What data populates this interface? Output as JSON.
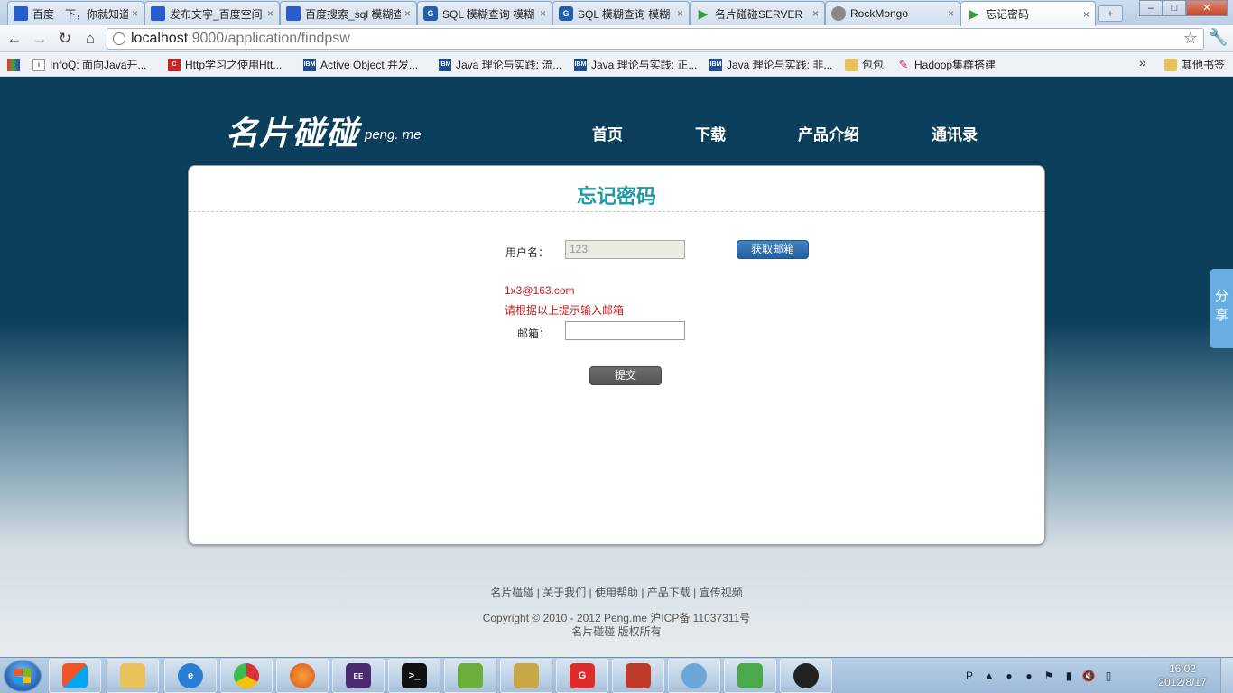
{
  "browser": {
    "tabs": [
      {
        "label": "百度一下，你就知道",
        "icon": "baidu-icon",
        "close": "×"
      },
      {
        "label": "发布文字_百度空间",
        "icon": "baidu-icon",
        "close": "×"
      },
      {
        "label": "百度搜索_sql 模糊查询",
        "icon": "baidu-icon",
        "close": "×"
      },
      {
        "label": "SQL 模糊查询 模糊",
        "icon": "g-icon",
        "close": "×"
      },
      {
        "label": "SQL 模糊查询 模糊",
        "icon": "g-icon",
        "close": "×"
      },
      {
        "label": "名片碰碰SERVER",
        "icon": "play-icon",
        "close": "×"
      },
      {
        "label": "RockMongo",
        "icon": "mongo-icon",
        "close": "×"
      },
      {
        "label": "忘记密码",
        "icon": "play-icon",
        "close": "×"
      }
    ],
    "new_tab": "+",
    "minimize": "–",
    "maximize": "□",
    "close": "✕",
    "back": "←",
    "forward": "→",
    "reload": "↻",
    "home": "⌂",
    "url_host": "localhost",
    "url_rest": ":9000/application/findpsw",
    "star": "☆",
    "wrench": "🔧",
    "bookmarks": [
      {
        "label": "",
        "icon": "google-apps-icon"
      },
      {
        "label": "InfoQ: 面向Java开...",
        "icon": "infoq-icon"
      },
      {
        "label": "Http学习之使用Htt...",
        "icon": "c-icon"
      },
      {
        "label": "Active Object 并发...",
        "icon": "ibm-icon"
      },
      {
        "label": "Java 理论与实践: 流...",
        "icon": "ibm-icon"
      },
      {
        "label": "Java 理论与实践: 正...",
        "icon": "ibm-icon"
      },
      {
        "label": "Java 理论与实践: 非...",
        "icon": "ibm-icon"
      },
      {
        "label": "包包",
        "icon": "folder-icon"
      },
      {
        "label": "Hadoop集群搭建",
        "icon": "feather-icon"
      }
    ],
    "bookmarks_more": "»",
    "other_bookmarks": "其他书签"
  },
  "site": {
    "logo": "名片碰碰",
    "logo_sub": "peng. me",
    "nav": [
      "首页",
      "下载",
      "产品介绍",
      "通讯录"
    ],
    "share": "分享"
  },
  "form": {
    "title": "忘记密码",
    "username_label": "用户名：",
    "username_value": "123",
    "get_email_button": "获取邮箱",
    "hint_email": "1x3@163.com",
    "hint_text": "请根据以上提示输入邮箱",
    "email_label": "邮箱：",
    "email_value": "",
    "submit_button": "提交"
  },
  "footer": {
    "links": "名片碰碰 | 关于我们 | 使用帮助 | 产品下载 | 宣传视频",
    "copyright": "Copyright © 2010 - 2012 Peng.me 沪ICP备 11037311号",
    "rights": "名片碰碰 版权所有"
  },
  "taskbar": {
    "apps": [
      "file-manager",
      "ie",
      "chrome",
      "firefox",
      "java-ee-ide",
      "terminal",
      "editor",
      "tools",
      "flashget",
      "toolbox",
      "search-tool",
      "messenger",
      "qq"
    ],
    "time": "16:02",
    "date": "2012/8/17"
  },
  "colors": {
    "header_bg": "#0c3f5c",
    "title_teal": "#1c9aa6",
    "button_blue": "#2462a0",
    "hint_red": "#c21a1a"
  }
}
